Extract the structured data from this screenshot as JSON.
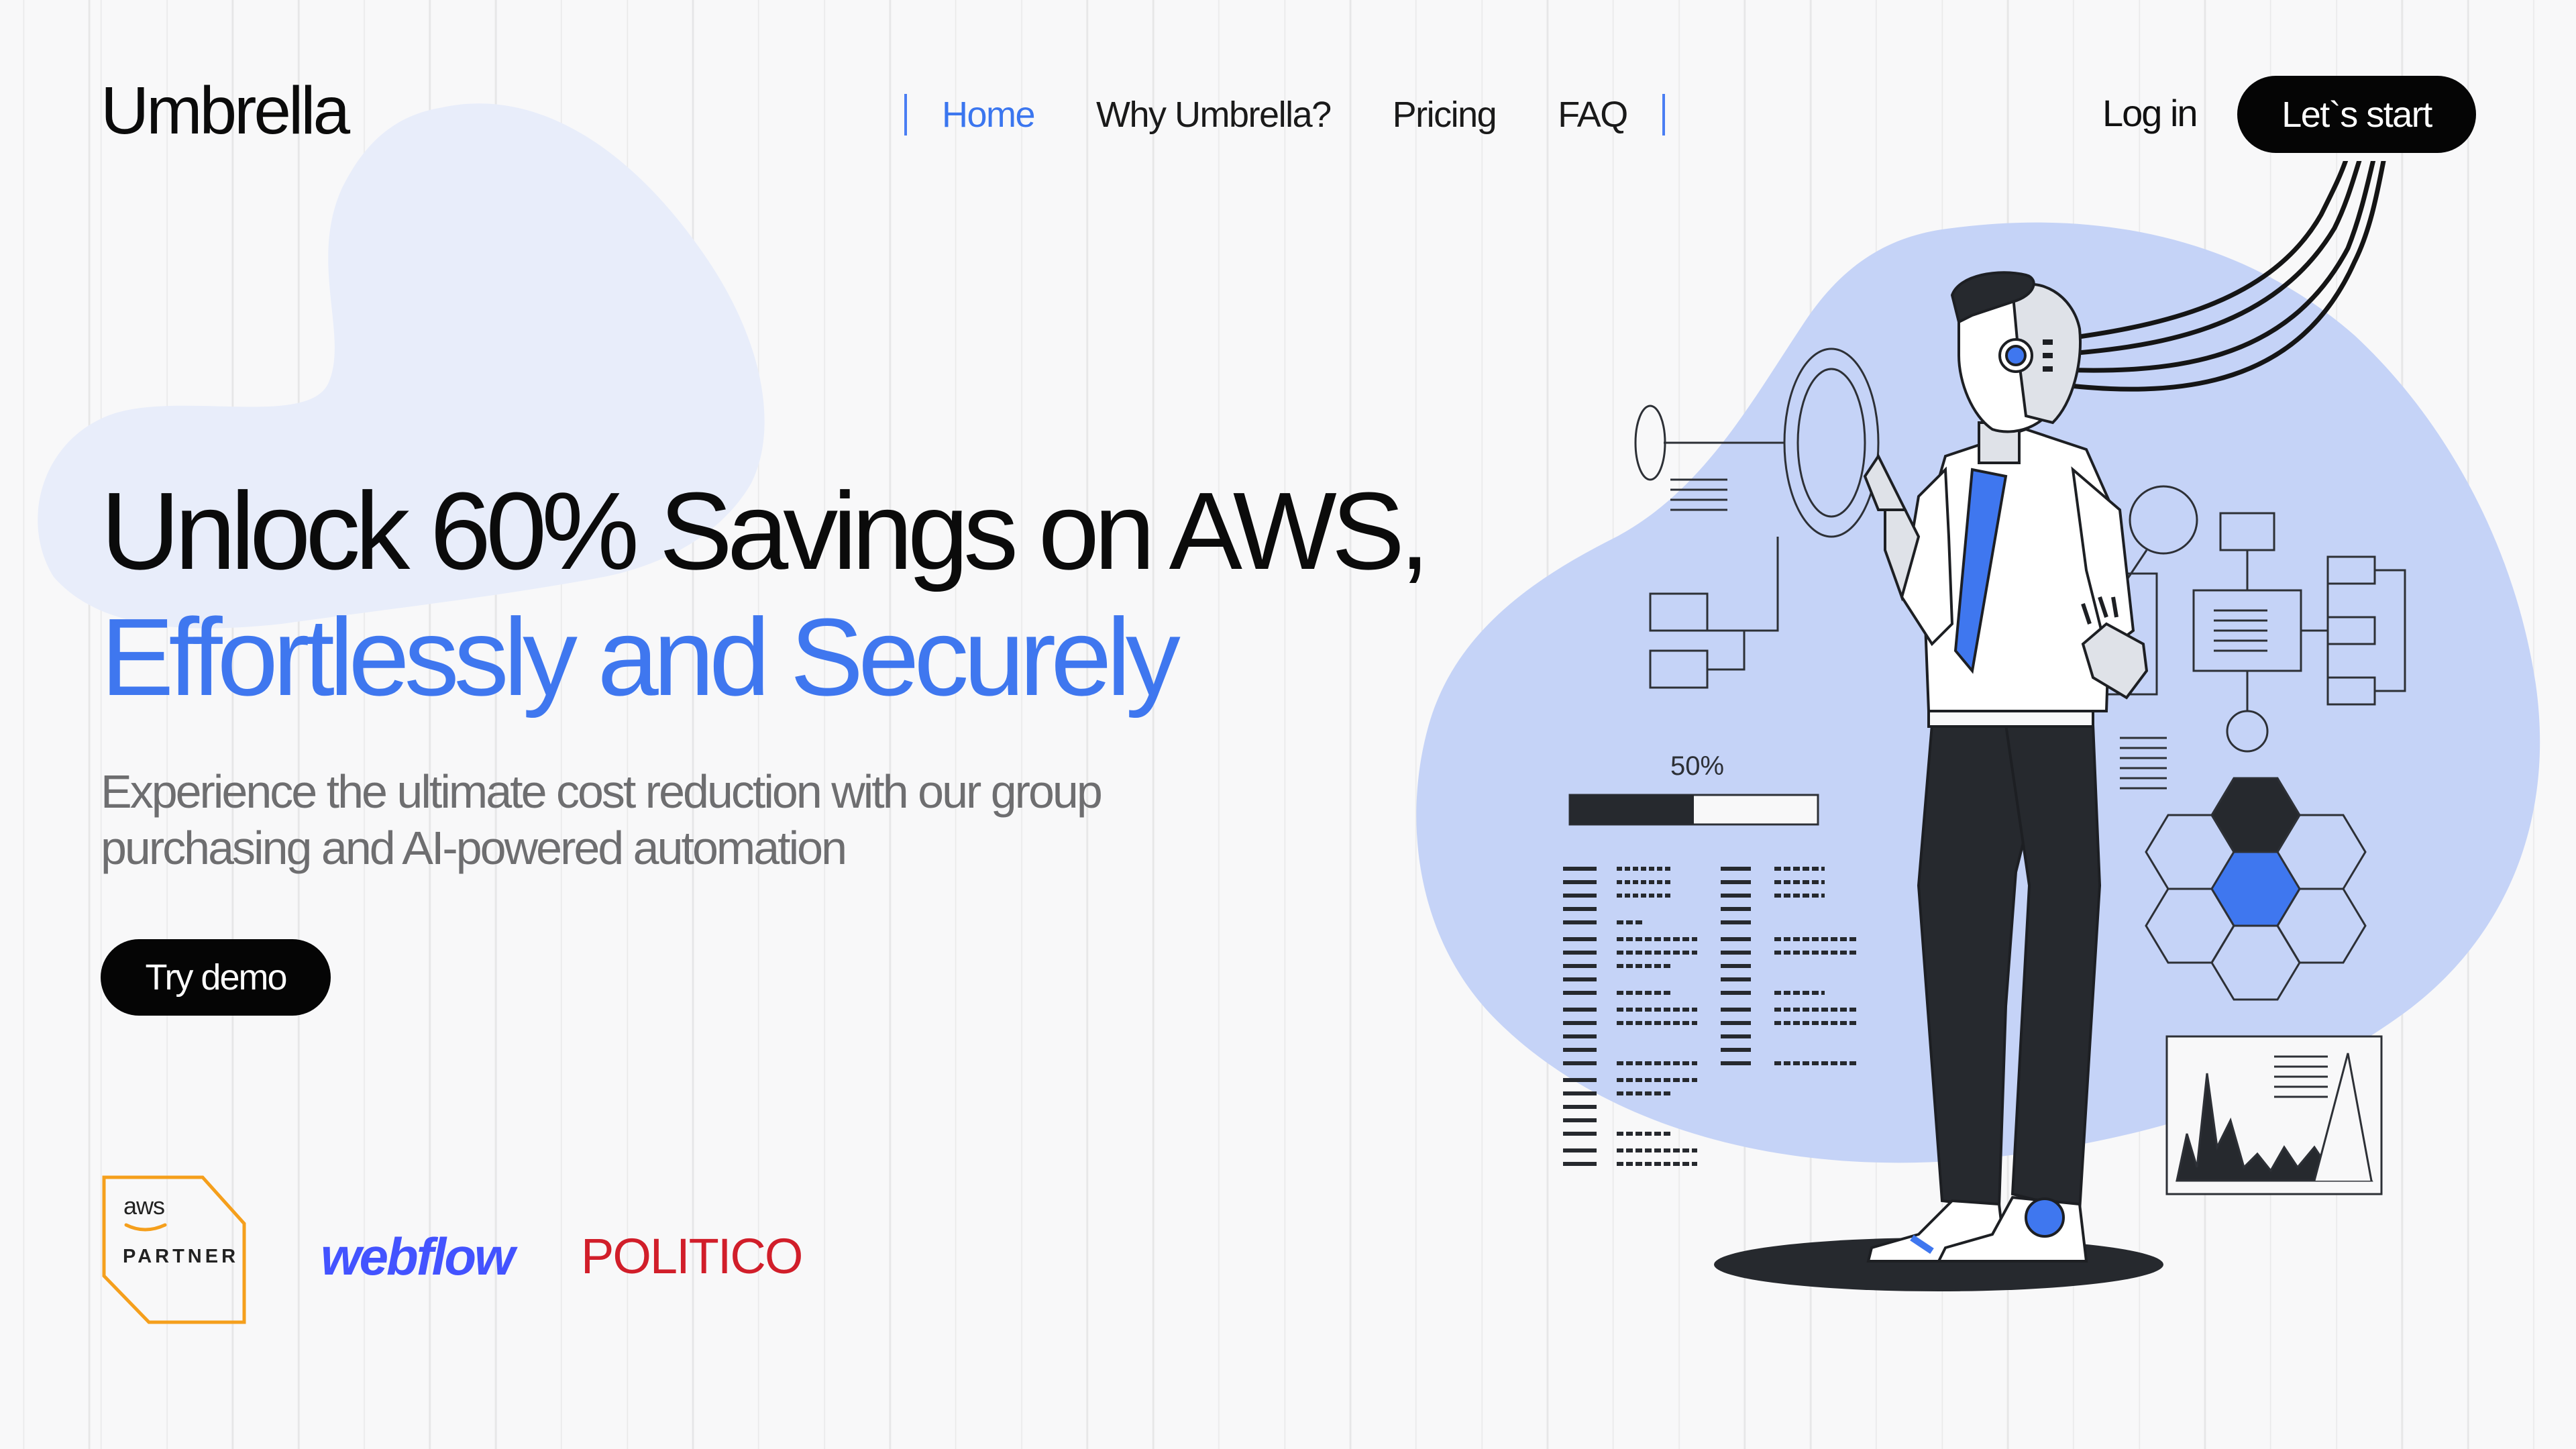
{
  "brand": {
    "name": "Umbrella"
  },
  "nav": {
    "items": [
      {
        "label": "Home",
        "active": true
      },
      {
        "label": "Why Umbrella?",
        "active": false
      },
      {
        "label": "Pricing",
        "active": false
      },
      {
        "label": "FAQ",
        "active": false
      }
    ]
  },
  "header": {
    "login_label": "Log in",
    "start_label": "Let`s start"
  },
  "hero": {
    "title_line1": "Unlock 60% Savings on AWS,",
    "title_line2": "Effortlessly and Securely",
    "subtitle": "Experience the ultimate cost reduction with our group purchasing and AI-powered automation",
    "demo_label": "Try demo"
  },
  "partners": {
    "aws_word": "aws",
    "aws_partner": "PARTNER",
    "webflow": "webflow",
    "politico": "POLITICO"
  },
  "illustration": {
    "progress_label": "50%",
    "progress_fraction": 0.5
  },
  "colors": {
    "accent": "#3f77ef",
    "blob_light": "#e8edfa",
    "blob_blue": "#c5d3f7",
    "dark": "#26292e",
    "aws_orange": "#f59f1c",
    "webflow_blue": "#4353ff",
    "politico_red": "#d11e2a"
  }
}
